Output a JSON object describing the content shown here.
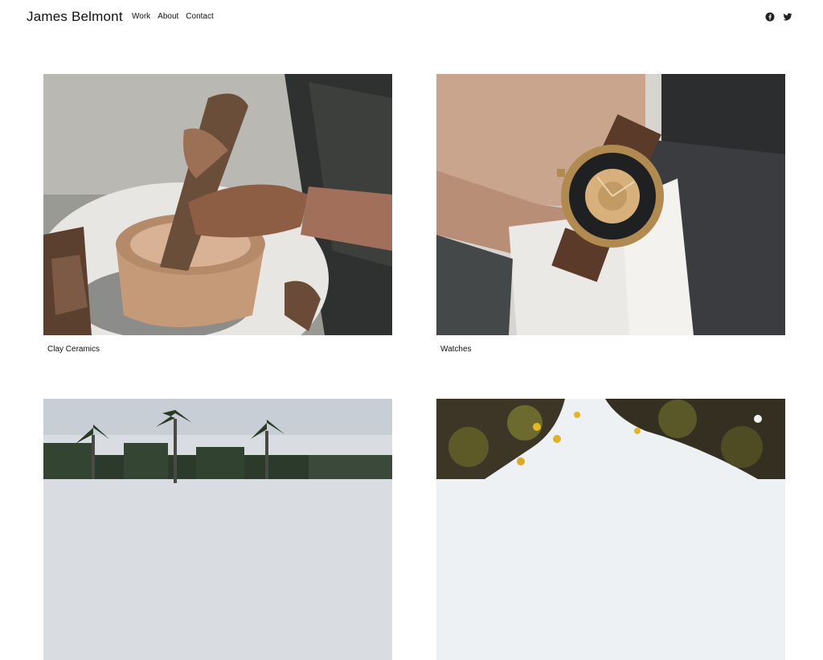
{
  "brand": {
    "name": "James Belmont"
  },
  "nav": {
    "items": [
      "Work",
      "About",
      "Contact"
    ]
  },
  "social": {
    "icons": [
      "facebook-icon",
      "twitter-icon"
    ]
  },
  "projects": [
    {
      "title": "Clay Ceramics"
    },
    {
      "title": "Watches"
    },
    {
      "title": ""
    },
    {
      "title": ""
    }
  ]
}
